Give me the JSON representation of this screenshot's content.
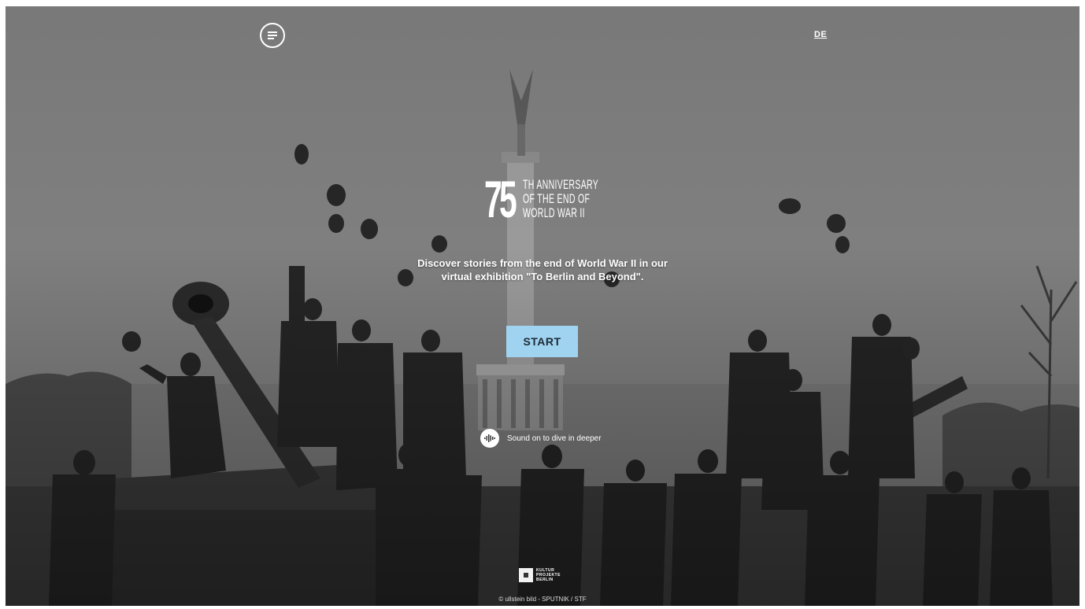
{
  "header": {
    "menu_icon": "hamburger-menu-icon",
    "language_label": "DE"
  },
  "hero": {
    "logo_number": "75",
    "logo_lines": [
      "TH ANNIVERSARY",
      "OF THE END OF",
      "WORLD WAR II"
    ],
    "tagline_line1": "Discover stories from the end of World War II in our",
    "tagline_line2": "virtual exhibition \"To Berlin and Beyond\".",
    "start_label": "START",
    "sound_icon": "sound-wave-icon",
    "sound_label": "Sound on to dive in deeper"
  },
  "footer": {
    "partner_lines": [
      "KULTUR",
      "PROJEKTE",
      "BERLIN"
    ],
    "credit": "© ullstein bild - SPUTNIK / STF"
  },
  "colors": {
    "accent": "#9fd3ef",
    "text": "#ffffff"
  }
}
